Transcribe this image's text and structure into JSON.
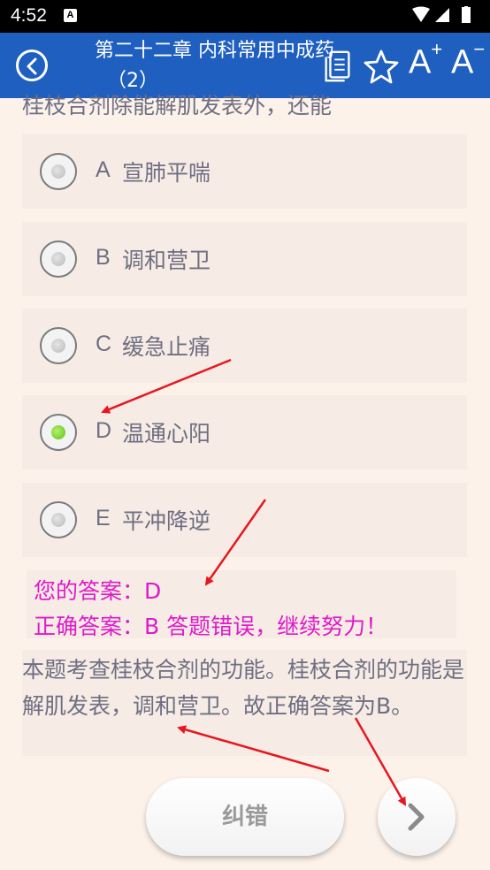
{
  "status_bar": {
    "time": "4:52",
    "notification_icon": "A"
  },
  "header": {
    "title_line1": "第二十二章 内科常用中成药",
    "title_line2": "（2）",
    "icons": [
      "back-icon",
      "sheet-icon",
      "star-icon",
      "font-increase-icon",
      "font-decrease-icon"
    ],
    "font_increase_label": "A",
    "font_increase_sup": "+",
    "font_decrease_label": "A",
    "font_decrease_sup": "−"
  },
  "question": {
    "text": "桂枝合剂除能解肌发表外，还能"
  },
  "options": [
    {
      "letter": "A",
      "text": "宣肺平喘",
      "selected": false
    },
    {
      "letter": "B",
      "text": "调和营卫",
      "selected": false
    },
    {
      "letter": "C",
      "text": "缓急止痛",
      "selected": false
    },
    {
      "letter": "D",
      "text": "温通心阳",
      "selected": true
    },
    {
      "letter": "E",
      "text": "平冲降逆",
      "selected": false
    }
  ],
  "answer": {
    "your_answer": "您的答案：D",
    "correct_answer": "正确答案：B 答题错误，继续努力！"
  },
  "explanation": "本题考查桂枝合剂的功能。桂枝合剂的功能是解肌发表，调和营卫。故正确答案为B。",
  "buttons": {
    "report_label": "纠错"
  },
  "colors": {
    "header": "#1f5fbf",
    "background": "#fcf2ea",
    "answer_text": "#e01ac9",
    "annotation_arrow": "#e8161e"
  }
}
